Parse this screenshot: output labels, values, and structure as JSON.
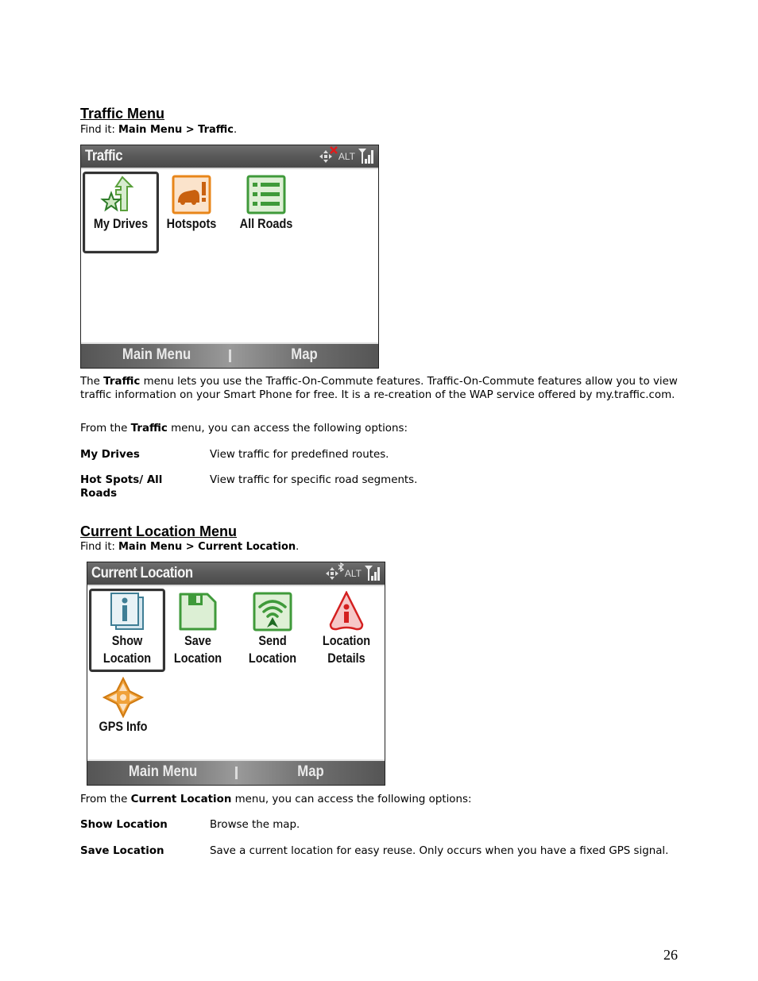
{
  "traffic_section": {
    "heading": "Traffic Menu",
    "find_it_prefix": "Find it: ",
    "find_it_path": "Main Menu > Traffic",
    "find_it_suffix": ".",
    "screen": {
      "title": "Traffic",
      "status": {
        "alt_label": "ALT",
        "icons": [
          "move-icon",
          "no-gps-x-icon",
          "signal-icon"
        ]
      },
      "tiles": [
        {
          "label": "My Drives",
          "icon": "my-drives-icon",
          "selected": true
        },
        {
          "label": "Hotspots",
          "icon": "hotspots-icon",
          "selected": false
        },
        {
          "label": "All Roads",
          "icon": "all-roads-icon",
          "selected": false
        }
      ],
      "softkeys": {
        "left": "Main Menu",
        "right": "Map"
      }
    },
    "description_parts": [
      {
        "text": "The ",
        "bold": false
      },
      {
        "text": "Traffic",
        "bold": true
      },
      {
        "text": " menu lets you use the Traffic-On-Commute features. Traffic-On-Commute features allow you to view traffic information on your Smart Phone for free.  It is a re-creation of the WAP service offered by my.traffic.com.",
        "bold": false
      }
    ],
    "options_intro_parts": [
      {
        "text": "From the ",
        "bold": false
      },
      {
        "text": "Traffic",
        "bold": true
      },
      {
        "text": " menu, you can access the following options:",
        "bold": false
      }
    ],
    "options": [
      {
        "label": "My Drives",
        "description": "View traffic for predefined routes."
      },
      {
        "label": "Hot Spots/ All Roads",
        "description": "View traffic for specific road segments."
      }
    ]
  },
  "location_section": {
    "heading": "Current Location Menu",
    "find_it_prefix": "Find it: ",
    "find_it_path": "Main Menu > Current Location",
    "find_it_suffix": ".",
    "screen": {
      "title": "Current Location",
      "status": {
        "alt_label": "ALT",
        "icons": [
          "move-icon",
          "bluetooth-icon",
          "signal-icon"
        ]
      },
      "tiles": [
        {
          "label": "Show Location",
          "line1": "Show",
          "line2": "Location",
          "icon": "show-location-icon",
          "selected": true
        },
        {
          "label": "Save Location",
          "line1": "Save",
          "line2": "Location",
          "icon": "save-location-icon",
          "selected": false
        },
        {
          "label": "Send Location",
          "line1": "Send",
          "line2": "Location",
          "icon": "send-location-icon",
          "selected": false
        },
        {
          "label": "Location Details",
          "line1": "Location",
          "line2": "Details",
          "icon": "location-details-icon",
          "selected": false
        },
        {
          "label": "GPS Info",
          "line1": "GPS Info",
          "line2": "",
          "icon": "gps-info-icon",
          "selected": false
        }
      ],
      "softkeys": {
        "left": "Main Menu",
        "right": "Map"
      }
    },
    "options_intro_parts": [
      {
        "text": "From the ",
        "bold": false
      },
      {
        "text": "Current Location",
        "bold": true
      },
      {
        "text": " menu, you can access the following options:",
        "bold": false
      }
    ],
    "options": [
      {
        "label": "Show Location",
        "description": "Browse the map."
      },
      {
        "label": "Save Location",
        "description": "Save a current location for easy reuse. Only occurs when you have a fixed GPS signal."
      }
    ]
  },
  "page_number": "26"
}
